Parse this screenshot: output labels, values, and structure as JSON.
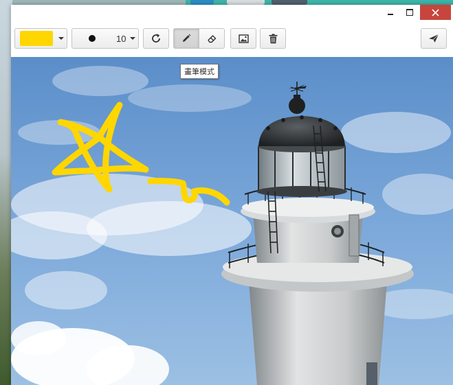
{
  "window": {
    "controls": {
      "minimize": "minimize",
      "maximize": "maximize",
      "close": "close"
    }
  },
  "toolbar": {
    "color_picker": {
      "selected_color": "#ffd600"
    },
    "brush_size": {
      "value": "10"
    },
    "tools": [
      {
        "name": "redo",
        "icon": "redo-icon"
      },
      {
        "name": "pen",
        "icon": "pencil-icon",
        "active": true
      },
      {
        "name": "eraser",
        "icon": "eraser-icon"
      },
      {
        "name": "insert-image",
        "icon": "image-icon"
      },
      {
        "name": "clear",
        "icon": "trash-icon"
      },
      {
        "name": "send",
        "icon": "send-icon"
      }
    ]
  },
  "tooltip": {
    "text": "畫筆模式"
  },
  "colors": {
    "accent": "#ffd600",
    "close_button": "#c7453c",
    "sky_top": "#5b8ec9",
    "sky_bottom": "#9cc0e3"
  }
}
